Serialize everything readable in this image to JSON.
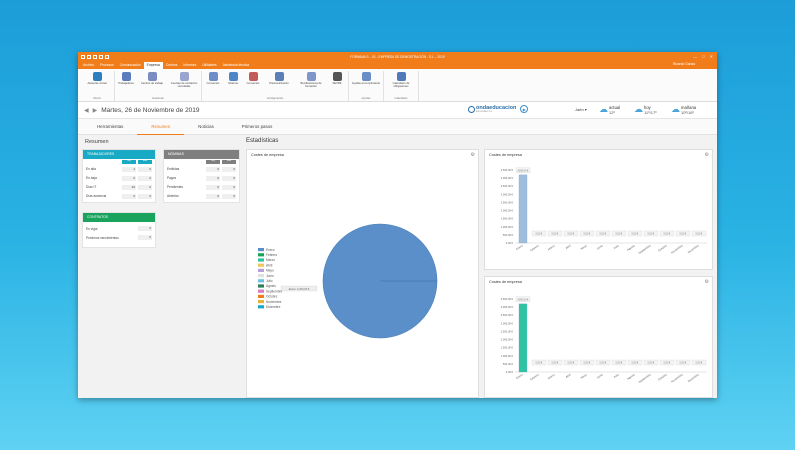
{
  "titlebar": {
    "title": "FORMAVA S. - 01 - EMPRESA DE DEMOSTRACIÓN - S.L. - 2019",
    "minimize": "—",
    "maximize": "□",
    "close": "✕"
  },
  "menu": {
    "items": [
      "Archivo",
      "Procesos",
      "Comunicación",
      "Empresa",
      "Centros",
      "Informes",
      "Utilidades",
      "Asistencia técnica"
    ],
    "active_index": 3,
    "user": "Ricardo Garcia"
  },
  "ribbon": {
    "groups": [
      {
        "label": "Ahorro",
        "buttons": [
          {
            "label": "Asistente virtual",
            "icon": "alpha-icon",
            "color": "#2d7fbf"
          }
        ]
      },
      {
        "label": "Gestionar",
        "buttons": [
          {
            "label": "Trabajadores",
            "icon": "workers-icon",
            "color": "#5b7dbd"
          },
          {
            "label": "Centros de trabajo",
            "icon": "workcenter-icon",
            "color": "#7a8cc2"
          },
          {
            "label": "Cuentas de cotización vinculadas",
            "icon": "accounts-icon",
            "color": "#9aa6cf"
          }
        ]
      },
      {
        "label": "Configuración",
        "buttons": [
          {
            "label": "Convenios",
            "icon": "agreement-icon",
            "color": "#6f8ec9"
          },
          {
            "label": "Sistema",
            "icon": "system-icon",
            "color": "#4e86c8"
          },
          {
            "label": "Convenios",
            "icon": "agreements-icon",
            "color": "#c45b5b"
          },
          {
            "label": "Parametrización",
            "icon": "params-icon",
            "color": "#5c7fb8"
          },
          {
            "label": "Bonificaciones de formación",
            "icon": "bonus-icon",
            "color": "#7f96c8"
          },
          {
            "label": "SEXPE",
            "icon": "sexpe-icon",
            "color": "#555555"
          }
        ]
      },
      {
        "label": "Ayudas",
        "buttons": [
          {
            "label": "Ayudas al cumplimiento",
            "icon": "help-icon",
            "color": "#6a8fc6"
          }
        ]
      },
      {
        "label": "Calendario",
        "buttons": [
          {
            "label": "Calendario de obligaciones",
            "icon": "calendar-icon",
            "color": "#4f79bb"
          }
        ]
      }
    ]
  },
  "datebar": {
    "prev": "◀",
    "next": "▶",
    "date": "Martes, 26 de Noviembre de 2019",
    "logo_text": "ondaeducacion",
    "logo_sub": "EN DIRECTO",
    "city": "Jaén",
    "weather": [
      {
        "label": "actual",
        "temp": "12º"
      },
      {
        "label": "hoy",
        "temp": "11º/17º"
      },
      {
        "label": "mañana",
        "temp": "10º/16º"
      }
    ]
  },
  "tabs": {
    "items": [
      "Herramientas",
      "Resumen",
      "Noticias",
      "Primeros pasos"
    ],
    "active_index": 1
  },
  "content": {
    "resumen_title": "Resumen",
    "estadisticas_title": "Estadísticas",
    "trabajadores": {
      "title": "TRABAJADORES",
      "col1": "Hoy",
      "col2": "Mes",
      "rows": [
        {
          "label": "En alta",
          "v1": "4",
          "v2": "0"
        },
        {
          "label": "En baja",
          "v1": "0",
          "v2": "0"
        },
        {
          "label": "Días IT",
          "v1": "20",
          "v2": "0"
        },
        {
          "label": "Días ausencia",
          "v1": "0",
          "v2": "0"
        }
      ]
    },
    "nominas": {
      "title": "NÓMINAS",
      "col1": "Hoy",
      "col2": "Mes",
      "rows": [
        {
          "label": "Emitidas",
          "v1": "0",
          "v2": "0"
        },
        {
          "label": "Pagos",
          "v1": "0",
          "v2": "0"
        },
        {
          "label": "Pendientes",
          "v1": "0",
          "v2": "0"
        },
        {
          "label": "Abiertos",
          "v1": "0",
          "v2": "0"
        }
      ]
    },
    "contratos": {
      "title": "CONTRATOS",
      "rows": [
        {
          "label": "En vigor",
          "v1": "0"
        },
        {
          "label": "Próximos vencimientos",
          "v1": "0"
        }
      ]
    }
  },
  "colors": {
    "orange": "#f07d1a",
    "teal": "#18aac4",
    "gray_head": "#7f7f7f",
    "green_head": "#1aa35c",
    "bar_blue": "#9fbddd",
    "bar_green": "#2fc4a1",
    "pie_blue": "#5b8fc9"
  },
  "chart_data": [
    {
      "type": "pie",
      "title": "Costes de empresa",
      "legend": [
        "Enero",
        "Febrero",
        "Marzo",
        "Abril",
        "Mayo",
        "Junio",
        "Julio",
        "Agosto",
        "Septiembre",
        "Octubre",
        "Noviembre",
        "Diciembre"
      ],
      "legend_colors": [
        "#5b8fc9",
        "#1aa35c",
        "#2fc4a1",
        "#f0c75a",
        "#b9a0d6",
        "#e0e0e0",
        "#6cc0e5",
        "#2e7d5b",
        "#d87cbf",
        "#f07d1a",
        "#e3b33a",
        "#18aac4"
      ],
      "values": [
        100,
        0,
        0,
        0,
        0,
        0,
        0,
        0,
        0,
        0,
        0,
        0
      ],
      "slice_label": "Enero: 4.200,00 €"
    },
    {
      "type": "bar",
      "title": "Costes de empresa",
      "categories": [
        "Enero",
        "Febrero",
        "Marzo",
        "Abril",
        "Mayo",
        "Junio",
        "Julio",
        "Agosto",
        "Septiembre",
        "Octubre",
        "Noviembre",
        "Diciembre"
      ],
      "values": [
        4200,
        0,
        0,
        0,
        0,
        0,
        0,
        0,
        0,
        0,
        0,
        0
      ],
      "ylim": [
        0,
        4500
      ],
      "yticks": [
        "0,00 €",
        "500,00 €",
        "1.000,00 €",
        "1.500,00 €",
        "2.000,00 €",
        "2.500,00 €",
        "3.000,00 €",
        "3.500,00 €",
        "4.000,00 €",
        "4.500,00 €"
      ],
      "color": "#9fbddd"
    },
    {
      "type": "bar",
      "title": "Costes de empresa",
      "categories": [
        "Enero",
        "Febrero",
        "Marzo",
        "Abril",
        "Mayo",
        "Junio",
        "Julio",
        "Agosto",
        "Septiembre",
        "Octubre",
        "Noviembre",
        "Diciembre"
      ],
      "values": [
        4200,
        0,
        0,
        0,
        0,
        0,
        0,
        0,
        0,
        0,
        0,
        0
      ],
      "ylim": [
        0,
        4500
      ],
      "yticks": [
        "0,00 €",
        "500,00 €",
        "1.000,00 €",
        "1.500,00 €",
        "2.000,00 €",
        "2.500,00 €",
        "3.000,00 €",
        "3.500,00 €",
        "4.000,00 €",
        "4.500,00 €"
      ],
      "color": "#2fc4a1"
    }
  ]
}
